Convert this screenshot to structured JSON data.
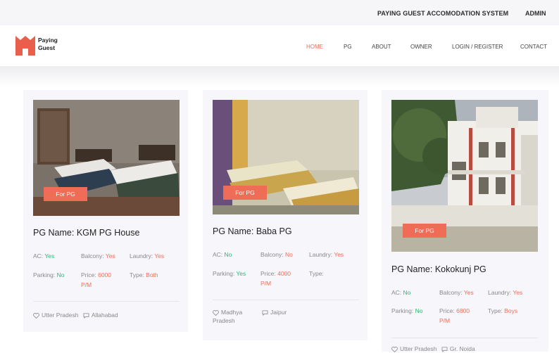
{
  "topbar": {
    "system_title": "PAYING GUEST ACCOMODATION SYSTEM",
    "admin_label": "ADMIN"
  },
  "logo": {
    "line1": "Paying",
    "line2": "Guest"
  },
  "nav": {
    "home": "HOME",
    "pg": "PG",
    "about": "ABOUT",
    "owner": "OWNER",
    "login": "LOGIN / REGISTER",
    "contact": "CONTACT"
  },
  "colors": {
    "accent": "#ef6c57",
    "yes": "#2bb673"
  },
  "cards": [
    {
      "badge": "For PG",
      "name": "PG Name: KGM PG House",
      "ac_label": "AC:",
      "ac": "Yes",
      "balcony_label": "Balcony:",
      "balcony": "Yes",
      "laundry_label": "Laundry:",
      "laundry": "Yes",
      "parking_label": "Parking:",
      "parking": "No",
      "price_label": "Price:",
      "price_1": "6000",
      "price_2": "P/M",
      "type_label": "Type:",
      "type": "Both",
      "state": "Utter Pradesh",
      "city": "Allahabad"
    },
    {
      "badge": "For PG",
      "name": "PG Name: Baba PG",
      "ac_label": "AC:",
      "ac": "No",
      "balcony_label": "Balcony:",
      "balcony": "No",
      "laundry_label": "Laundry:",
      "laundry": "Yes",
      "parking_label": "Parking:",
      "parking": "Yes",
      "price_label": "Price:",
      "price_1": "4000",
      "price_2": "P/M",
      "type_label": "Type:",
      "type": "",
      "state_1": "Madhya",
      "state_2": "Pradesh",
      "city": "Jaipur"
    },
    {
      "badge": "For PG",
      "name": "PG Name: Kokokunj PG",
      "ac_label": "AC:",
      "ac": "No",
      "balcony_label": "Balcony:",
      "balcony": "Yes",
      "laundry_label": "Laundry:",
      "laundry": "Yes",
      "parking_label": "Parking:",
      "parking": "No",
      "price_label": "Price:",
      "price_1": "6800",
      "price_2": "P/M",
      "type_label": "Type:",
      "type": "Boys",
      "state": "Utter Pradesh",
      "city": "Gr. Noida"
    }
  ]
}
